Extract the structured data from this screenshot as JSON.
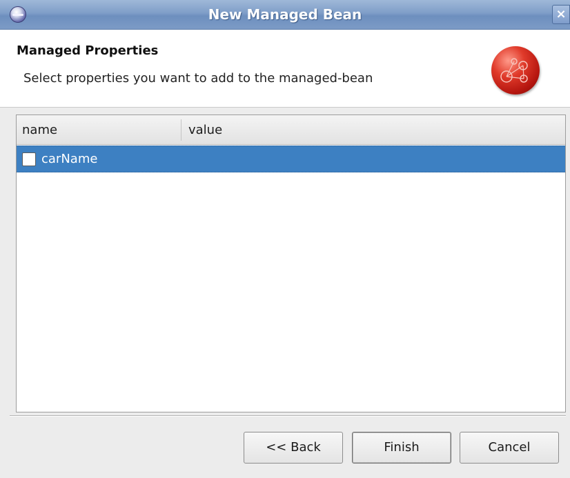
{
  "window": {
    "title": "New Managed Bean",
    "app_icon": "eclipse-icon",
    "close_label": "×"
  },
  "header": {
    "title": "Managed Properties",
    "description": "Select properties you want to add to the managed-bean",
    "logo_icon": "wizard-logo-icon"
  },
  "table": {
    "columns": [
      "name",
      "value"
    ],
    "rows": [
      {
        "name": "carName",
        "value": "",
        "checked": false,
        "selected": true
      }
    ]
  },
  "buttons": {
    "back": "<< Back",
    "finish": "Finish",
    "cancel": "Cancel"
  },
  "colors": {
    "titlebar": "#7f9ec8",
    "selection": "#3d80c2",
    "logo": "#e03a2a"
  }
}
